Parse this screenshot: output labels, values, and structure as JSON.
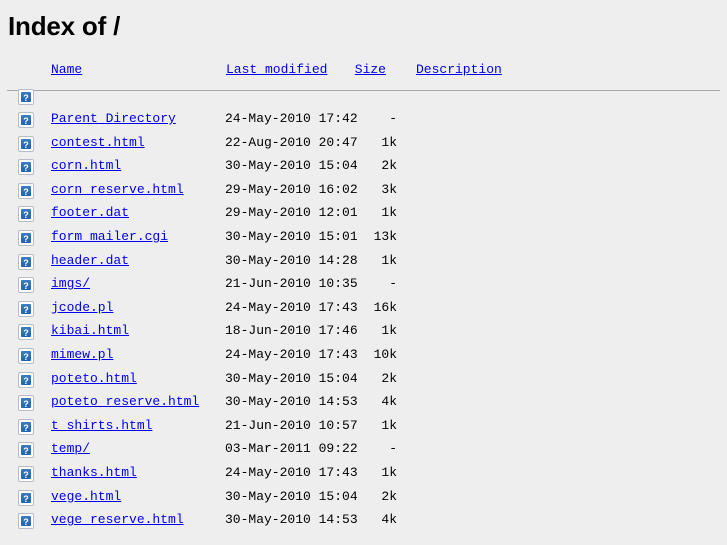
{
  "page": {
    "title_prefix": "Index of ",
    "title_path": "/"
  },
  "icons": {
    "broken_image": "broken-image-icon"
  },
  "table": {
    "headers": {
      "icon": "",
      "name": "Name",
      "last_modified": "Last modified",
      "size": "Size",
      "description": "Description"
    },
    "rows": [
      {
        "name": "Parent Directory",
        "last_modified": "24-May-2010 17:42",
        "size": "-",
        "description": ""
      },
      {
        "name": "contest.html",
        "last_modified": "22-Aug-2010 20:47",
        "size": "1k",
        "description": ""
      },
      {
        "name": "corn.html",
        "last_modified": "30-May-2010 15:04",
        "size": "2k",
        "description": ""
      },
      {
        "name": "corn_reserve.html",
        "last_modified": "29-May-2010 16:02",
        "size": "3k",
        "description": ""
      },
      {
        "name": "footer.dat",
        "last_modified": "29-May-2010 12:01",
        "size": "1k",
        "description": ""
      },
      {
        "name": "form_mailer.cgi",
        "last_modified": "30-May-2010 15:01",
        "size": "13k",
        "description": ""
      },
      {
        "name": "header.dat",
        "last_modified": "30-May-2010 14:28",
        "size": "1k",
        "description": ""
      },
      {
        "name": "imgs/",
        "last_modified": "21-Jun-2010 10:35",
        "size": "-",
        "description": ""
      },
      {
        "name": "jcode.pl",
        "last_modified": "24-May-2010 17:43",
        "size": "16k",
        "description": ""
      },
      {
        "name": "kibai.html",
        "last_modified": "18-Jun-2010 17:46",
        "size": "1k",
        "description": ""
      },
      {
        "name": "mimew.pl",
        "last_modified": "24-May-2010 17:43",
        "size": "10k",
        "description": ""
      },
      {
        "name": "poteto.html",
        "last_modified": "30-May-2010 15:04",
        "size": "2k",
        "description": ""
      },
      {
        "name": "poteto_reserve.html",
        "last_modified": "30-May-2010 14:53",
        "size": "4k",
        "description": ""
      },
      {
        "name": "t_shirts.html",
        "last_modified": "21-Jun-2010 10:57",
        "size": "1k",
        "description": ""
      },
      {
        "name": "temp/",
        "last_modified": "03-Mar-2011 09:22",
        "size": "-",
        "description": ""
      },
      {
        "name": "thanks.html",
        "last_modified": "24-May-2010 17:43",
        "size": "1k",
        "description": ""
      },
      {
        "name": "vege.html",
        "last_modified": "30-May-2010 15:04",
        "size": "2k",
        "description": ""
      },
      {
        "name": "vege_reserve.html",
        "last_modified": "30-May-2010 14:53",
        "size": "4k",
        "description": ""
      }
    ]
  },
  "colors": {
    "background": "#eeeeee",
    "link": "#0000ee",
    "text": "#000000",
    "rule": "#a8a8a8",
    "icon_blue": "#2a6fbb"
  }
}
